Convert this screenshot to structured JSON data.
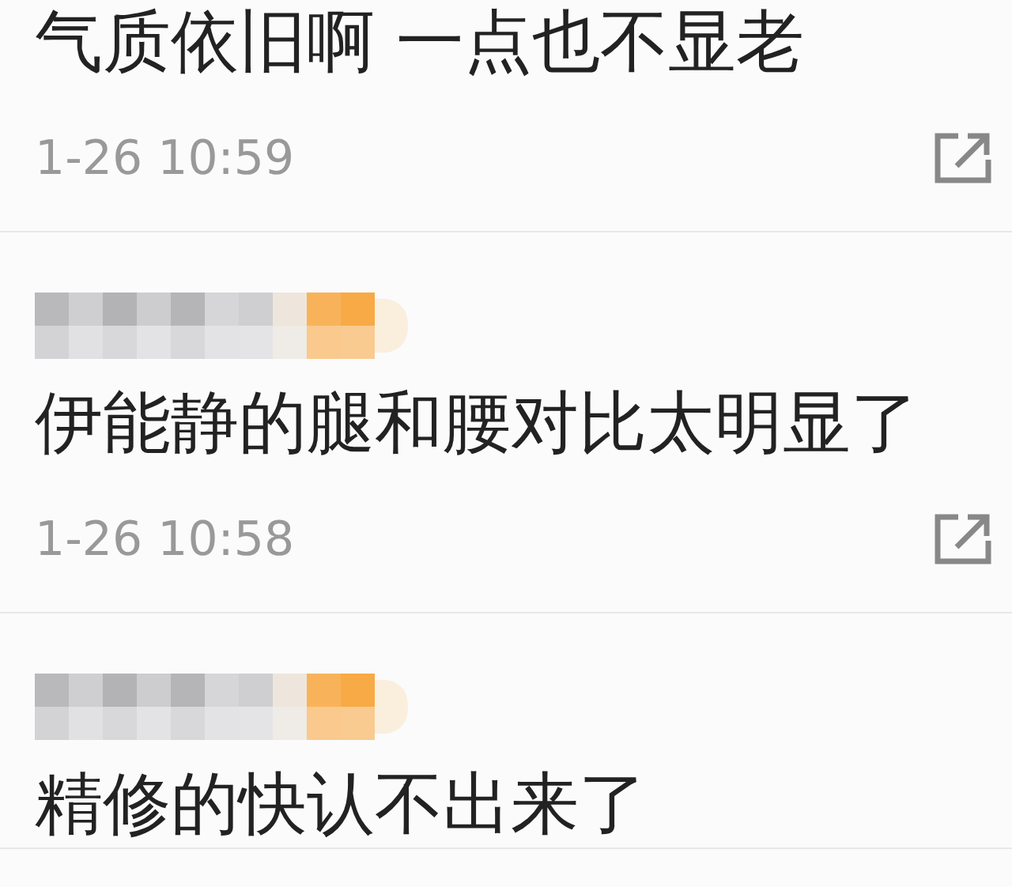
{
  "comments": [
    {
      "name_blurred": false,
      "text": "气质依旧啊 一点也不显老",
      "time": "1-26 10:59"
    },
    {
      "name_blurred": true,
      "text": "伊能静的腿和腰对比太明显了",
      "time": "1-26 10:58"
    },
    {
      "name_blurred": true,
      "text": "精修的快认不出来了"
    }
  ]
}
